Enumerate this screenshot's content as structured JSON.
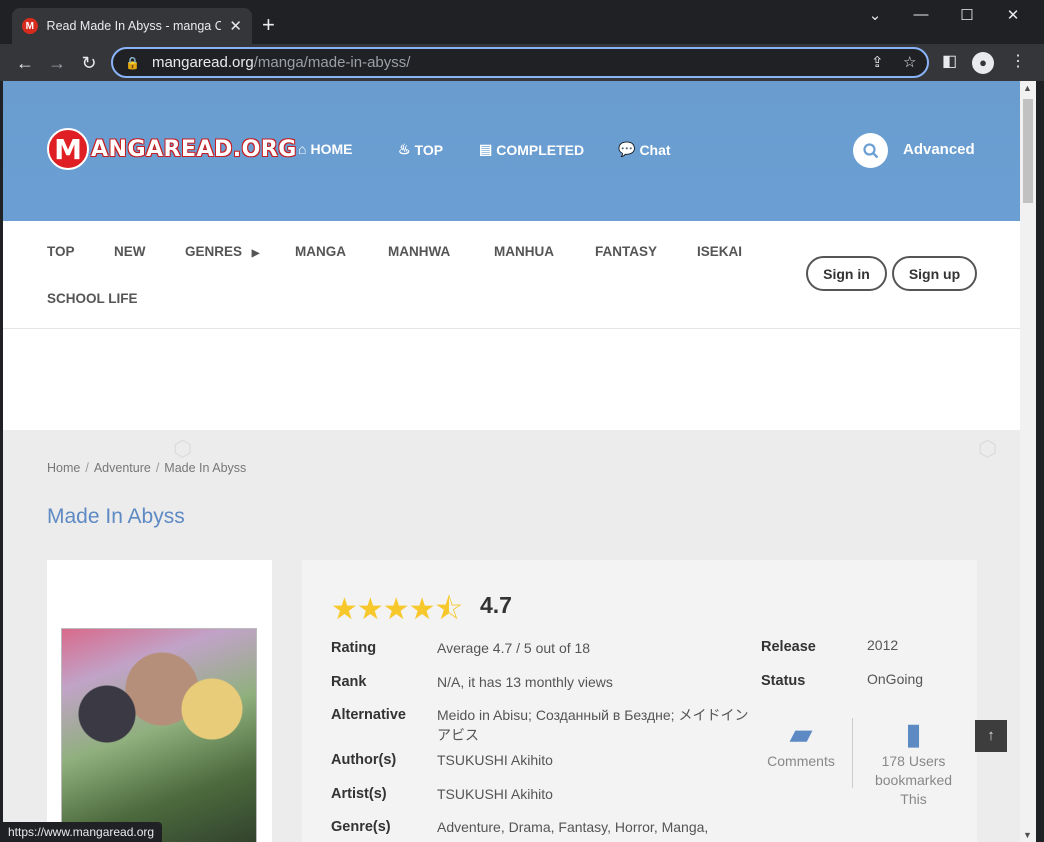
{
  "browser": {
    "tab_title": "Read Made In Abyss - manga Online",
    "tab_favicon": "M",
    "url_host": "mangaread.org",
    "url_path": "/manga/made-in-abyss/",
    "status_url": "https://www.mangaread.org"
  },
  "header": {
    "logo_letter": "M",
    "logo_text": "ANGAREAD.ORG",
    "nav": [
      {
        "label": "HOME",
        "icon": "home-icon",
        "glyph": "⌂"
      },
      {
        "label": "TOP",
        "icon": "fire-icon",
        "glyph": "♨"
      },
      {
        "label": "COMPLETED",
        "icon": "list-icon",
        "glyph": "▤"
      },
      {
        "label": "Chat",
        "icon": "chat-icon",
        "glyph": "💬"
      }
    ],
    "advanced": "Advanced"
  },
  "subnav": {
    "items": [
      "TOP",
      "NEW",
      "GENRES",
      "MANGA",
      "MANHWA",
      "MANHUA",
      "FANTASY",
      "ISEKAI",
      "SCHOOL LIFE"
    ],
    "genres_arrow": "▶",
    "sign_in": "Sign in",
    "sign_up": "Sign up"
  },
  "breadcrumb": [
    "Home",
    "Adventure",
    "Made In Abyss"
  ],
  "manga": {
    "title": "Made In Abyss",
    "stars": "★★★★⯪",
    "score": "4.7",
    "rows": [
      {
        "label": "Rating",
        "value": "Average 4.7 / 5 out of 18"
      },
      {
        "label": "Rank",
        "value": "N/A, it has 13 monthly views"
      },
      {
        "label": "Alternative",
        "value": "Meido in Abisu; Созданный в Бездне; メイドインアビス"
      },
      {
        "label": "Author(s)",
        "value": "TSUKUSHI Akihito"
      },
      {
        "label": "Artist(s)",
        "value": "TSUKUSHI Akihito"
      },
      {
        "label": "Genre(s)",
        "value": "Adventure,  Drama,  Fantasy,  Horror,  Manga,"
      }
    ],
    "side": [
      {
        "label": "Release",
        "value": "2012"
      },
      {
        "label": "Status",
        "value": "OnGoing"
      }
    ],
    "comments_label": "Comments",
    "bookmark_label": "178 Users bookmarked This"
  },
  "colors": {
    "header_blue": "#6b9fd3",
    "title_blue": "#5e8ac4",
    "star_yellow": "#f7c82c"
  }
}
